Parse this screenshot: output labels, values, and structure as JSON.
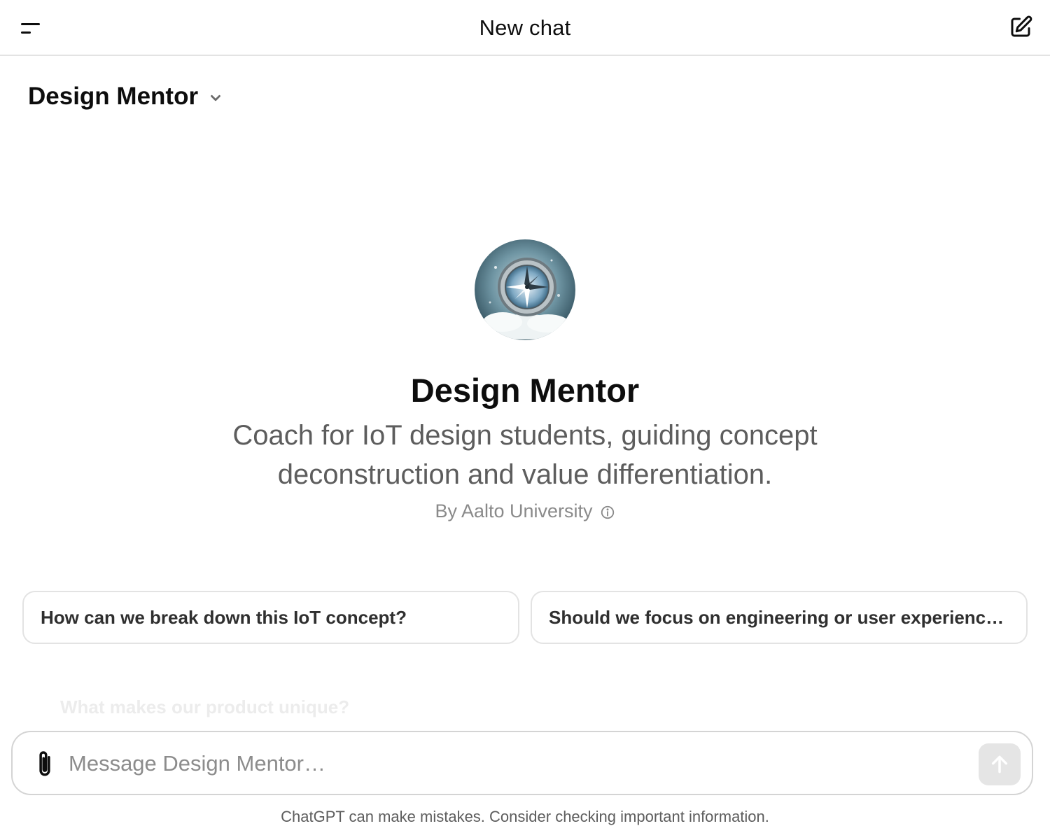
{
  "header": {
    "title": "New chat",
    "menu_icon": "sidebar-toggle-icon",
    "new_chat_icon": "edit-icon"
  },
  "gpt_selector": {
    "label": "Design Mentor",
    "icon": "chevron-down-icon"
  },
  "hero": {
    "avatar_icon": "compass-avatar",
    "title": "Design Mentor",
    "description": "Coach for IoT design students, guiding concept deconstruction and value differentiation.",
    "author": "By Aalto University",
    "info_icon": "info-icon"
  },
  "starters": [
    {
      "label": "How can we break down this IoT concept?"
    },
    {
      "label": "Should we focus on engineering or user experience first?"
    },
    {
      "label": "What makes our product unique?"
    }
  ],
  "composer": {
    "placeholder": "Message Design Mentor…",
    "attach_icon": "paperclip-icon",
    "send_icon": "arrow-up-icon"
  },
  "footer": {
    "disclaimer": "ChatGPT can make mistakes. Consider checking important information."
  },
  "colors": {
    "text_primary": "#0d0d0d",
    "text_secondary": "#5d5d5d",
    "border": "#e3e3e3",
    "send_disabled_bg": "#e5e5e5"
  }
}
